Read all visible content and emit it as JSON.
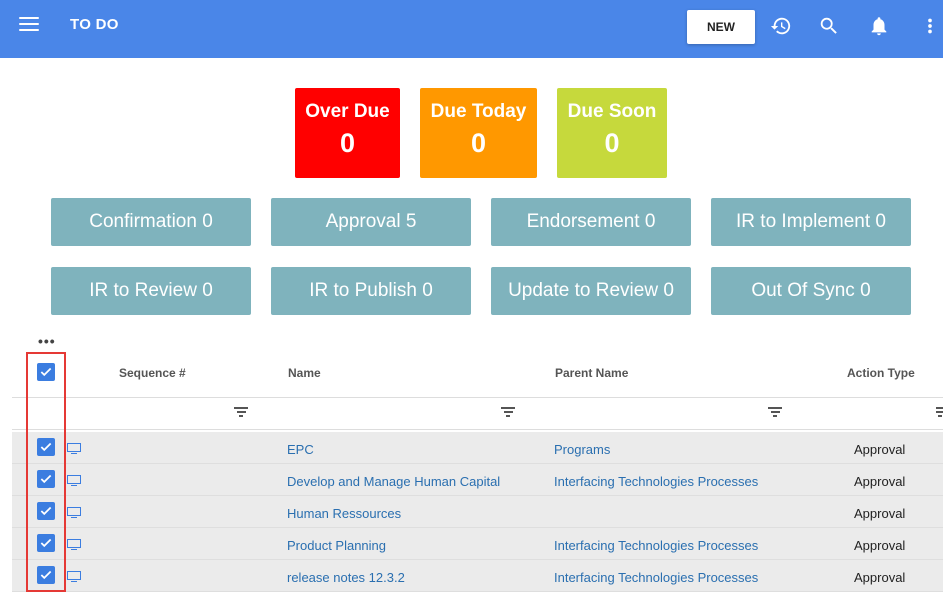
{
  "header": {
    "title": "TO DO",
    "new_label": "NEW",
    "icons": [
      "menu-icon",
      "history-icon",
      "search-icon",
      "bell-icon",
      "more-vert-icon"
    ]
  },
  "tiles": [
    {
      "label": "Over Due",
      "count": "0",
      "color": "#ff0000"
    },
    {
      "label": "Due Today",
      "count": "0",
      "color": "#ff9800"
    },
    {
      "label": "Due Soon",
      "count": "0",
      "color": "#c6d93c"
    }
  ],
  "categories": [
    "Confirmation 0",
    "Approval 5",
    "Endorsement 0",
    "IR to Implement 0",
    "IR to Review 0",
    "IR to Publish 0",
    "Update to Review 0",
    "Out Of Sync 0"
  ],
  "grid": {
    "more_label": "•••",
    "columns": [
      "Sequence #",
      "Name",
      "Parent Name",
      "Action Type"
    ],
    "rows": [
      {
        "name": "EPC",
        "parent": "Programs",
        "action": "Approval",
        "checked": true
      },
      {
        "name": "Develop and Manage Human Capital",
        "parent": "Interfacing Technologies Processes",
        "action": "Approval",
        "checked": true
      },
      {
        "name": "Human Ressources",
        "parent": "",
        "action": "Approval",
        "checked": true
      },
      {
        "name": "Product Planning",
        "parent": "Interfacing Technologies Processes",
        "action": "Approval",
        "checked": true
      },
      {
        "name": "release notes 12.3.2",
        "parent": "Interfacing Technologies Processes",
        "action": "Approval",
        "checked": true
      }
    ]
  },
  "colors": {
    "topbar": "#4a86e8",
    "category": "#7fb3bd",
    "link": "#2a6fb0",
    "checkbox": "#3b7de0",
    "highlight": "#e53935"
  }
}
